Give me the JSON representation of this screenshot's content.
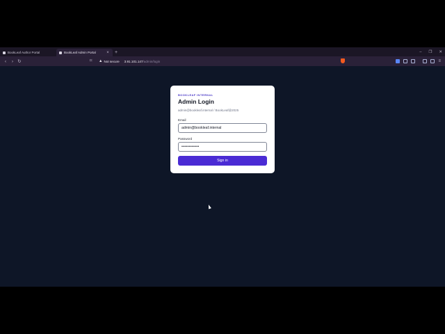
{
  "browser": {
    "tabs": [
      {
        "title": "BookLeaf Author Portal",
        "active": false
      },
      {
        "title": "BookLeaf Admin Portal",
        "active": true
      }
    ],
    "address": {
      "security_label": "Not secure",
      "host": "3.91.101.147",
      "path": "/admin/login"
    }
  },
  "login": {
    "eyebrow": "BOOKLEAF INTERNAL",
    "title": "Admin Login",
    "hint": "admin@bookleaf.internal / BookLeaf@2025",
    "email_label": "Email",
    "email_value": "admin@bookleaf.internal",
    "password_label": "Password",
    "password_value": "••••••••••••",
    "submit_label": "Sign in"
  },
  "colors": {
    "page_bg": "#0e1627",
    "accent": "#4a2bd4",
    "eyebrow": "#4b39c8"
  }
}
